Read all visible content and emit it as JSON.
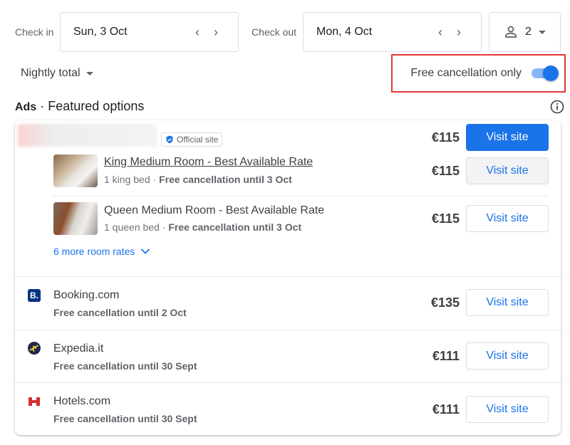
{
  "dates": {
    "checkin_label": "Check in",
    "checkin_value": "Sun, 3 Oct",
    "checkout_label": "Check out",
    "checkout_value": "Mon, 4 Oct",
    "guests": "2"
  },
  "filters": {
    "price_mode": "Nightly total",
    "free_cancel_label": "Free cancellation only",
    "free_cancel_on": true
  },
  "section": {
    "ads": "Ads",
    "sep": "·",
    "title": "Featured options"
  },
  "featured": {
    "badge": "Official site",
    "price": "€115",
    "button": "Visit site",
    "rooms": [
      {
        "title": "King Medium Room - Best Available Rate",
        "bed": "1 king bed",
        "sep": " · ",
        "cancel": "Free cancellation until 3 Oct",
        "price": "€115",
        "button": "Visit site"
      },
      {
        "title": "Queen Medium Room - Best Available Rate",
        "bed": "1 queen bed",
        "sep": " · ",
        "cancel": "Free cancellation until 3 Oct",
        "price": "€115",
        "button": "Visit site"
      }
    ],
    "more": "6 more room rates"
  },
  "providers": [
    {
      "name": "Booking.com",
      "cancel": "Free cancellation until 2 Oct",
      "price": "€135",
      "button": "Visit site",
      "icon": "booking-logo"
    },
    {
      "name": "Expedia.it",
      "cancel": "Free cancellation until 30 Sept",
      "price": "€111",
      "button": "Visit site",
      "icon": "expedia-logo"
    },
    {
      "name": "Hotels.com",
      "cancel": "Free cancellation until 30 Sept",
      "price": "€111",
      "button": "Visit site",
      "icon": "hotels-logo"
    }
  ],
  "colors": {
    "accent": "#1a73e8",
    "highlight": "#e53935"
  }
}
